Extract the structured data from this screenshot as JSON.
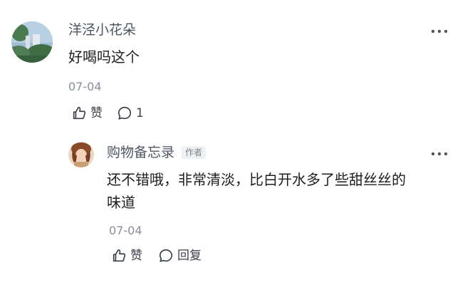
{
  "comment": {
    "username": "洋泾小花朵",
    "text": "好喝吗这个",
    "date": "07-04",
    "like_label": "赞",
    "reply_count": "1",
    "more_icon": "more-dots-icon"
  },
  "reply": {
    "username": "购物备忘录",
    "badge": "作者",
    "text_line1": "还不错哦，非常清淡，比白开水多了些甜丝丝的",
    "text_line2": "味道",
    "date": "07-04",
    "like_label": "赞",
    "reply_label": "回复",
    "more_icon": "more-dots-icon"
  },
  "icons": {
    "like": "thumbs-up-icon",
    "comment": "comment-bubble-icon"
  }
}
